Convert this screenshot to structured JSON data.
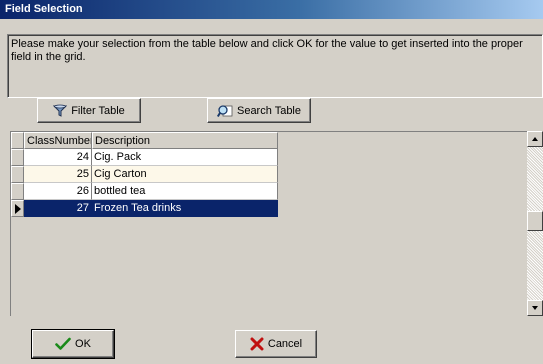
{
  "window": {
    "title": "Field Selection"
  },
  "instructions": "Please make your selection from the table below and click OK for the value to get inserted into the proper field in the grid.",
  "toolbar": {
    "filter_label": "Filter Table",
    "filter_icon": "funnel-icon",
    "search_label": "Search Table",
    "search_icon": "magnifier-icon"
  },
  "table": {
    "columns": [
      "ClassNumber",
      "Description"
    ],
    "rows": [
      {
        "class_number": "24",
        "description": "Cig. Pack"
      },
      {
        "class_number": "25",
        "description": "Cig Carton"
      },
      {
        "class_number": "26",
        "description": "bottled tea"
      },
      {
        "class_number": "27",
        "description": "Frozen Tea drinks"
      }
    ],
    "selected_index": 3,
    "selection_color": "#0a246a"
  },
  "buttons": {
    "ok_label": "OK",
    "ok_icon": "checkmark-icon",
    "cancel_label": "Cancel",
    "cancel_icon": "x-icon"
  }
}
